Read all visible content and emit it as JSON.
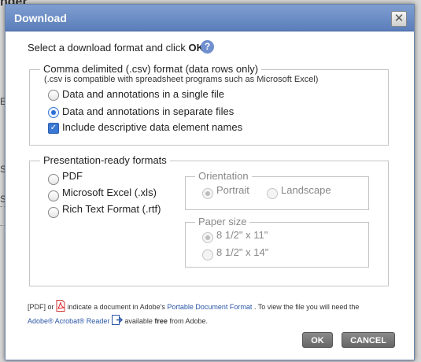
{
  "background": {
    "heading_fragment": "nder",
    "e_fragment": "E",
    "s_fragment_1": "S",
    "s_fragment_2": "S"
  },
  "dialog": {
    "title": "Download",
    "close_label": "✕",
    "intro_text": "Select a download format and click ",
    "intro_bold": "OK",
    "intro_end": ".",
    "help_label": "?"
  },
  "csv_group": {
    "legend": "Comma delimited (.csv) format (data rows only)",
    "note": "(.csv is compatible with spreadsheet programs such as Microsoft Excel)",
    "options": [
      {
        "label": "Data and annotations in a single file",
        "checked": false
      },
      {
        "label": "Data and annotations in separate files",
        "checked": true
      }
    ],
    "checkbox_label": "Include descriptive data element names",
    "checkbox_checked": true
  },
  "presentation_group": {
    "legend": "Presentation-ready formats",
    "options": [
      {
        "label": "PDF",
        "checked": false
      },
      {
        "label": "Microsoft Excel (.xls)",
        "checked": false
      },
      {
        "label": "Rich Text Format (.rtf)",
        "checked": false
      }
    ],
    "orientation": {
      "legend": "Orientation",
      "options": [
        {
          "label": "Portrait",
          "checked": true
        },
        {
          "label": "Landscape",
          "checked": false
        }
      ]
    },
    "paper_size": {
      "legend": "Paper size",
      "options": [
        {
          "label": "8 1/2\" x 11\"",
          "checked": true
        },
        {
          "label": "8 1/2\" x 14\"",
          "checked": false
        }
      ]
    }
  },
  "footer": {
    "pdf_prefix": "[PDF] or",
    "line1_mid": "indicate a document in Adobe's",
    "link_pdf": "Portable Document Format",
    "line1_end": ". To view the file you will need the",
    "link_reader": "Adobe® Acrobat® Reader",
    "line2_mid": "available",
    "free": "free",
    "line2_end": "from Adobe."
  },
  "buttons": {
    "ok_label": "OK",
    "cancel_label": "CANCEL"
  },
  "colors": {
    "title_bar": "#5b7dba",
    "accent": "#2a6fd6",
    "button": "#767676"
  }
}
